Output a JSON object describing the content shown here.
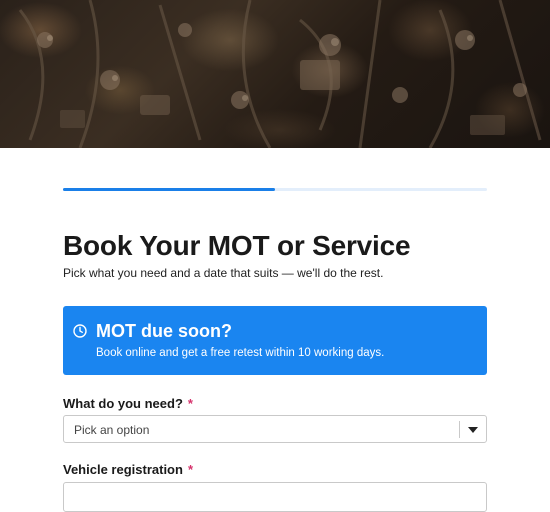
{
  "hero": {
    "image_alt": "engine parts photo"
  },
  "progress": {
    "value": 0.5,
    "track_color": "#e3eefb",
    "fill_color": "#1a7fe8"
  },
  "page": {
    "title": "Book Your MOT or Service",
    "subtitle": "Pick what you need and a date that suits — we'll do the rest."
  },
  "notice": {
    "icon": "clock-icon",
    "title": "MOT due soon?",
    "text": "Book online and get a free retest within 10 working days.",
    "bg_color": "#1a85f0"
  },
  "form": {
    "service": {
      "label": "What do you need?",
      "required_mark": "*",
      "placeholder": "Pick an option"
    },
    "registration": {
      "label": "Vehicle registration",
      "required_mark": "*",
      "value": ""
    }
  }
}
